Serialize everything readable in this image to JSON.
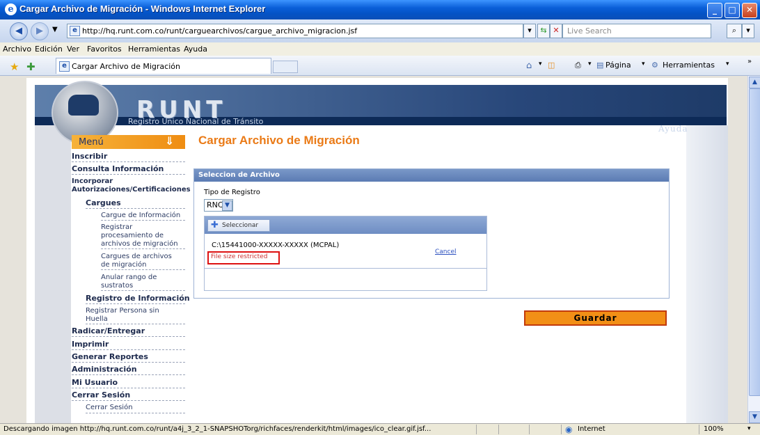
{
  "window": {
    "title": "Cargar Archivo de Migración - Windows Internet Explorer"
  },
  "address": {
    "url": "http://hq.runt.com.co/runt/carguearchivos/cargue_archivo_migracion.jsf"
  },
  "search": {
    "placeholder": "Live Search"
  },
  "menubar": [
    "Archivo",
    "Edición",
    "Ver",
    "Favoritos",
    "Herramientas",
    "Ayuda"
  ],
  "tab": {
    "title": "Cargar Archivo de Migración"
  },
  "commandbar": {
    "page": "Página",
    "tools": "Herramientas"
  },
  "site": {
    "logo": "RUNT",
    "subtitle": "Registro Único Nacional de Tránsito",
    "help": "Ayuda"
  },
  "sidebar": {
    "header": "Menú",
    "items": [
      "Inscribir",
      "Consulta Información",
      "Incorporar",
      "Autorizaciones/Certificaciones",
      "Cargues",
      "Cargue de Información",
      "Registrar",
      "procesamiento de",
      "archivos de migración",
      "Cargues de archivos",
      "de migración",
      "Anular rango de",
      "sustratos",
      "Registro de Información",
      "Registrar Persona sin",
      "Huella",
      "Radicar/Entregar",
      "Imprimir",
      "Generar Reportes",
      "Administración",
      "Mi Usuario",
      "Cerrar Sesión",
      "Cerrar Sesión"
    ]
  },
  "main": {
    "title": "Cargar Archivo de Migración",
    "panel_title": "Seleccion de Archivo",
    "tipo_label": "Tipo de Registro",
    "tipo_value": "RNC",
    "select_button": "Seleccionar",
    "file_name": "C:\\15441000-XXXXX-XXXXX (MCPAL)",
    "file_message": "File size restricted",
    "cancel": "Cancel",
    "save": "Guardar"
  },
  "status": {
    "message": "Descargando imagen http://hq.runt.com.co/runt/a4j_3_2_1-SNAPSHOTorg/richfaces/renderkit/html/images/ico_clear.gif.jsf...",
    "zone": "Internet",
    "zoom": "100%"
  }
}
